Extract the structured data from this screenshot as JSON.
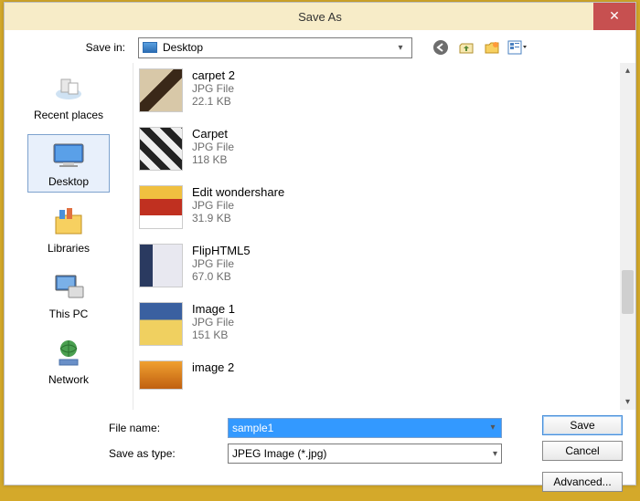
{
  "title": "Save As",
  "topbar": {
    "save_in_label": "Save in:",
    "location": "Desktop"
  },
  "places": [
    {
      "key": "recent",
      "label": "Recent places"
    },
    {
      "key": "desktop",
      "label": "Desktop",
      "selected": true
    },
    {
      "key": "libraries",
      "label": "Libraries"
    },
    {
      "key": "thispc",
      "label": "This PC"
    },
    {
      "key": "network",
      "label": "Network"
    }
  ],
  "files": [
    {
      "name": "carpet 2",
      "type": "JPG File",
      "size": "22.1 KB"
    },
    {
      "name": "Carpet",
      "type": "JPG File",
      "size": "118 KB"
    },
    {
      "name": "Edit wondershare",
      "type": "JPG File",
      "size": "31.9 KB"
    },
    {
      "name": "FlipHTML5",
      "type": "JPG File",
      "size": "67.0 KB"
    },
    {
      "name": "Image 1",
      "type": "JPG File",
      "size": "151 KB"
    },
    {
      "name": "image 2",
      "type": "",
      "size": ""
    }
  ],
  "form": {
    "file_name_label": "File name:",
    "file_name_value": "sample1",
    "save_as_type_label": "Save as type:",
    "save_as_type_value": "JPEG Image (*.jpg)"
  },
  "buttons": {
    "save": "Save",
    "cancel": "Cancel",
    "advanced": "Advanced..."
  },
  "colors": {
    "title_bg": "#f7ecc8",
    "close_bg": "#c75050",
    "selection_bg": "#3399ff"
  }
}
